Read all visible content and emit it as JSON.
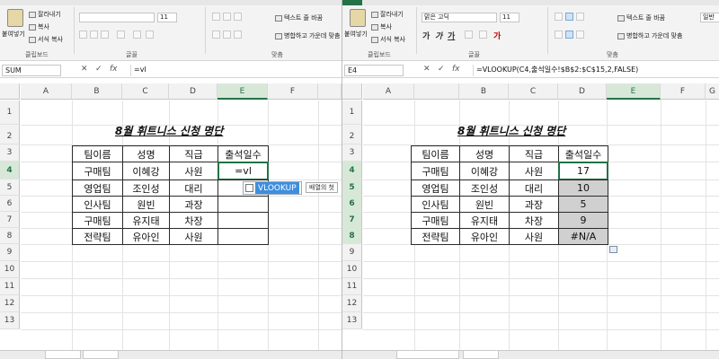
{
  "left": {
    "name_box": "SUM",
    "formula": "=vl",
    "editing_cell_text": "=vl",
    "ribbon": {
      "paste": "붙여넣기",
      "cut": "잘라내기",
      "copy": "복사",
      "format_painter": "서식 복사",
      "clipboard_group": "클립보드",
      "font_size": "11",
      "font_group": "글꼴",
      "wrap_text": "텍스트 줄 바꿈",
      "merge_center": "병합하고 가운데 맞춤",
      "align_group": "맞춤"
    },
    "autocomplete": {
      "item": "VLOOKUP",
      "tip": "배열의 첫",
      "icon": "function-icon"
    }
  },
  "right": {
    "name_box": "E4",
    "formula": "=VLOOKUP(C4,출석일수!$B$2:$C$15,2,FALSE)",
    "ribbon": {
      "file_tab": "파일",
      "paste": "붙여넣기",
      "cut": "잘라내기",
      "copy": "복사",
      "format_painter": "서식 복사",
      "clipboard_group": "클립보드",
      "font_name": "맑은 고딕",
      "font_size": "11",
      "font_group": "글꼴",
      "wrap_text": "텍스트 줄 바꿈",
      "merge_center": "병합하고 가운데 맞춤",
      "number_format": "일반",
      "align_group": "맞춤"
    },
    "results": [
      "17",
      "10",
      "5",
      "9",
      "#N/A"
    ]
  },
  "columns": [
    "A",
    "B",
    "C",
    "D",
    "E",
    "F",
    "G"
  ],
  "rows": [
    "1",
    "2",
    "3",
    "4",
    "5",
    "6",
    "7",
    "8",
    "9",
    "10",
    "11",
    "12",
    "13"
  ],
  "table": {
    "title": "8월 휘트니스 신청 명단",
    "headers": [
      "팀이름",
      "성명",
      "직급",
      "출석일수"
    ],
    "rows": [
      [
        "구매팀",
        "이혜강",
        "사원"
      ],
      [
        "영업팀",
        "조인성",
        "대리"
      ],
      [
        "인사팀",
        "원빈",
        "과장"
      ],
      [
        "구매팀",
        "유지태",
        "차장"
      ],
      [
        "전략팀",
        "유아인",
        "사원"
      ]
    ]
  },
  "colors": {
    "excel_green": "#217346",
    "selected_highlight": "#3e8ede",
    "result_fill": "#d0d0d0"
  }
}
